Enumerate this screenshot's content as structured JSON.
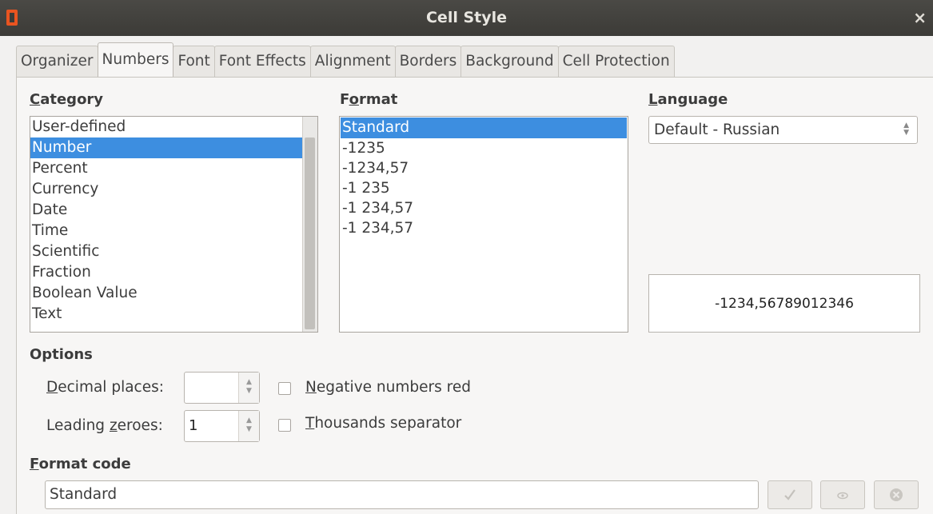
{
  "window": {
    "title": "Cell Style",
    "close_glyph": "×"
  },
  "tabs": [
    {
      "label": "Organizer"
    },
    {
      "label": "Numbers"
    },
    {
      "label": "Font"
    },
    {
      "label": "Font Effects"
    },
    {
      "label": "Alignment"
    },
    {
      "label": "Borders"
    },
    {
      "label": "Background"
    },
    {
      "label": "Cell Protection"
    }
  ],
  "active_tab": "Numbers",
  "category": {
    "label_accel": "C",
    "label_rest": "ategory",
    "items": [
      "User-defined",
      "Number",
      "Percent",
      "Currency",
      "Date",
      "Time",
      "Scientific",
      "Fraction",
      "Boolean Value",
      "Text"
    ],
    "selected": "Number"
  },
  "format": {
    "label_pre": "F",
    "label_accel": "o",
    "label_rest": "rmat",
    "items": [
      "Standard",
      "-1235",
      "-1234,57",
      "-1 235",
      "-1 234,57",
      "-1 234,57"
    ],
    "selected": "Standard"
  },
  "language": {
    "label_accel": "L",
    "label_rest": "anguage",
    "value": "Default - Russian"
  },
  "preview": {
    "value": "-1234,56789012346"
  },
  "options": {
    "label": "Options",
    "decimal_places_accel": "D",
    "decimal_places_rest": "ecimal places:",
    "decimal_places_value": "",
    "leading_zeroes_pre": "Leading ",
    "leading_zeroes_accel": "z",
    "leading_zeroes_rest": "eroes:",
    "leading_zeroes_value": "1",
    "negative_red_accel": "N",
    "negative_red_rest": "egative numbers red",
    "negative_red_checked": false,
    "thousands_accel": "T",
    "thousands_rest": "housands separator",
    "thousands_checked": false
  },
  "format_code": {
    "label_accel": "F",
    "label_rest": "ormat code",
    "value": "Standard"
  },
  "icons": {
    "apply": "check-icon",
    "comment": "eye-icon",
    "remove": "remove-icon",
    "spin_up": "▲",
    "spin_down": "▼"
  },
  "colors": {
    "selection": "#3d8ee0",
    "titlebar": "#3c3b37",
    "app_icon": "#e95420"
  }
}
